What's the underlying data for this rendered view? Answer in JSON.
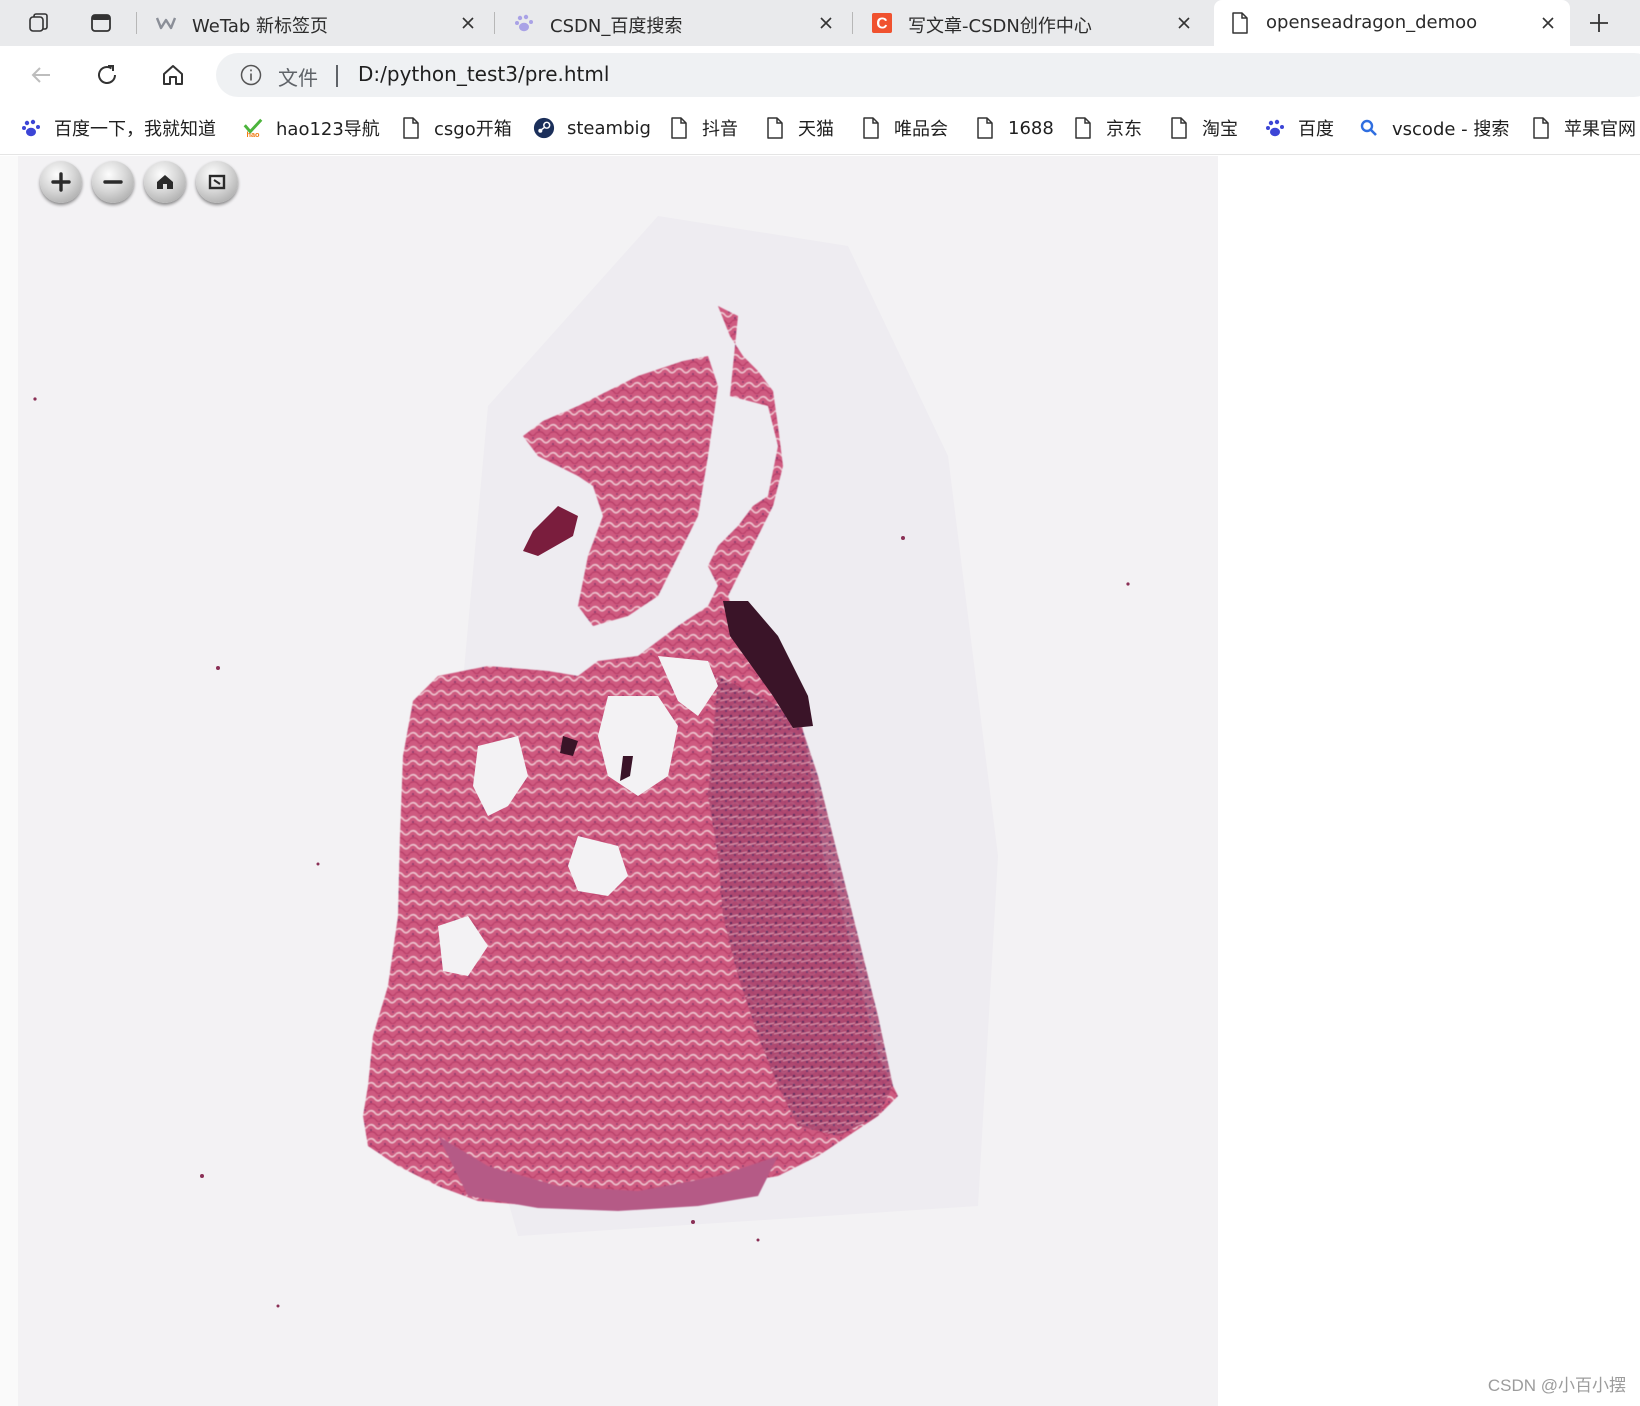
{
  "tabstrip": {
    "tabs": [
      {
        "title": "WeTab 新标签页",
        "icon": "wetab-icon",
        "active": false
      },
      {
        "title": "CSDN_百度搜索",
        "icon": "baidu-paw-icon",
        "active": false
      },
      {
        "title": "写文章-CSDN创作中心",
        "icon": "csdn-c-icon",
        "active": false
      },
      {
        "title": "openseadragon_demoo",
        "icon": "page-icon",
        "active": true
      }
    ]
  },
  "toolbar": {
    "scheme_label": "文件",
    "url": "D:/python_test3/pre.html"
  },
  "bookmarks": [
    {
      "label": "百度一下，我就知道",
      "icon": "baidu-paw-icon"
    },
    {
      "label": "hao123导航",
      "icon": "hao123-icon"
    },
    {
      "label": "csgo开箱",
      "icon": "page-icon"
    },
    {
      "label": "steambig",
      "icon": "steam-icon"
    },
    {
      "label": "抖音",
      "icon": "page-icon"
    },
    {
      "label": "天猫",
      "icon": "page-icon"
    },
    {
      "label": "唯品会",
      "icon": "page-icon"
    },
    {
      "label": "1688",
      "icon": "page-icon"
    },
    {
      "label": "京东",
      "icon": "page-icon"
    },
    {
      "label": "淘宝",
      "icon": "page-icon"
    },
    {
      "label": "百度",
      "icon": "baidu-paw-icon"
    },
    {
      "label": "vscode - 搜索",
      "icon": "search-icon"
    },
    {
      "label": "苹果官网",
      "icon": "page-icon"
    }
  ],
  "viewer": {
    "controls": [
      "zoom-in",
      "zoom-out",
      "home",
      "full-page"
    ],
    "tissue_color": "#c94a76",
    "background_color": "#f3f2f4"
  },
  "watermark": "CSDN @小百小摆"
}
